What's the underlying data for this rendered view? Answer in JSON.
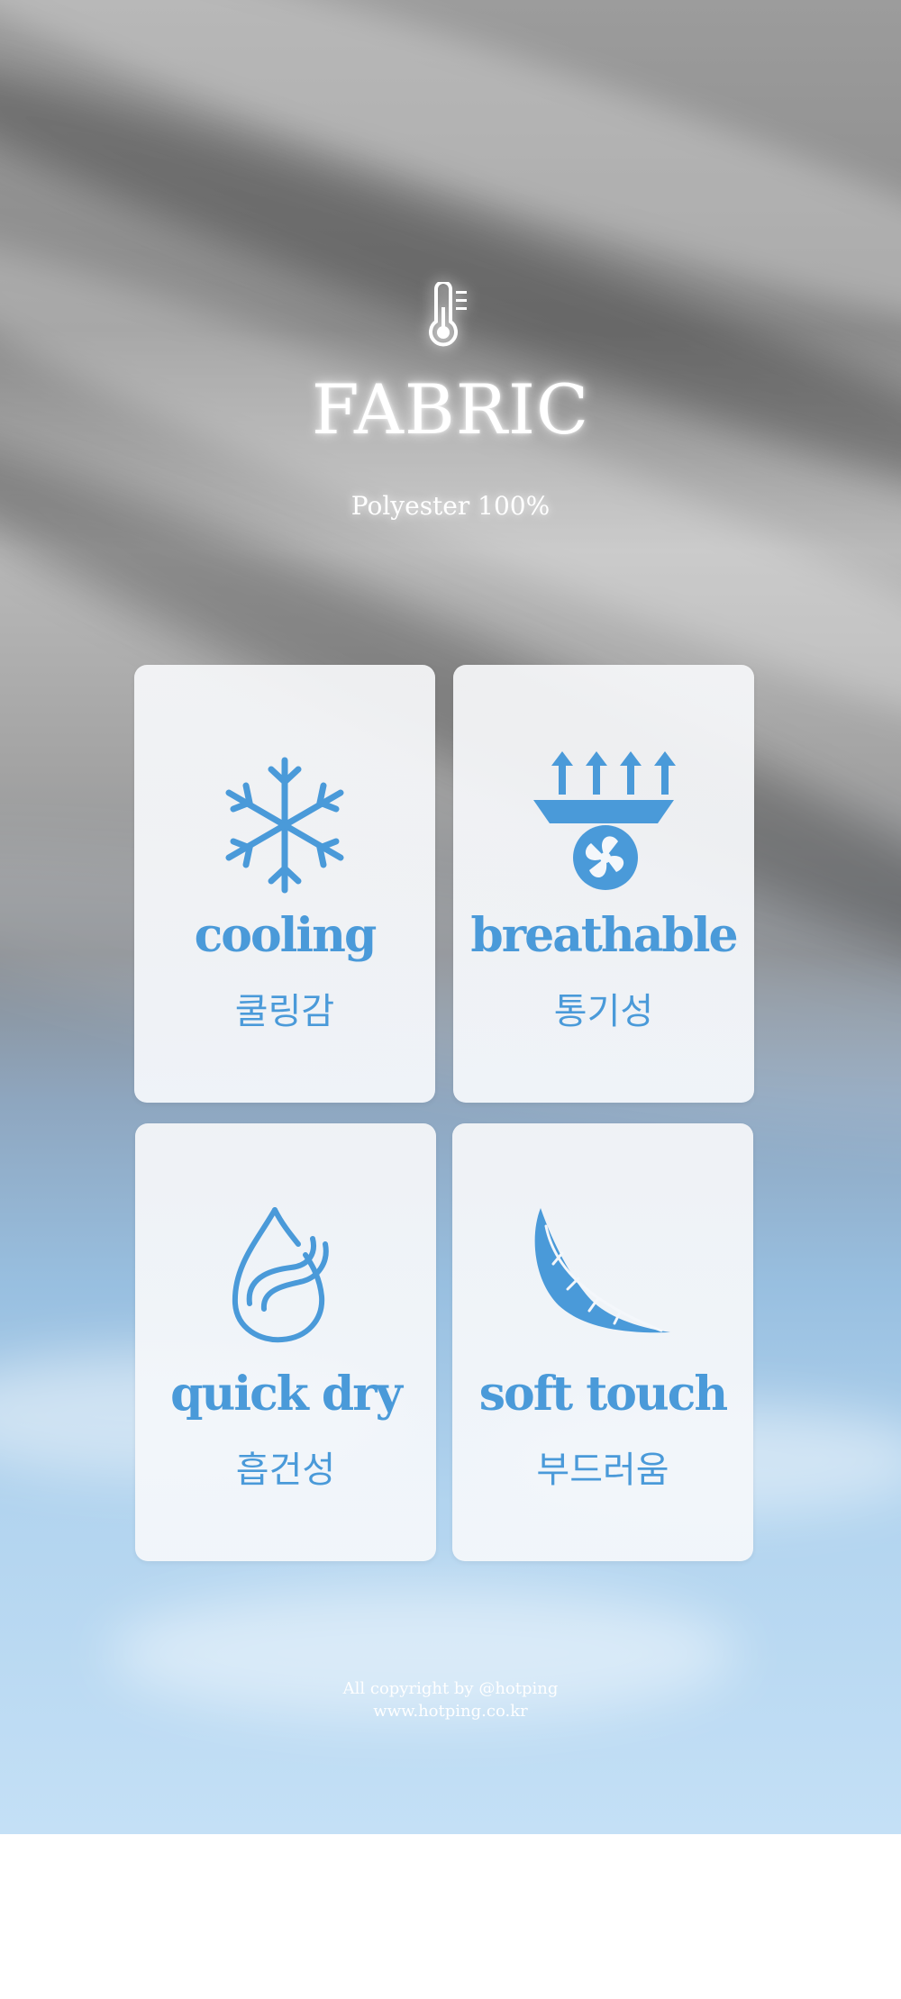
{
  "header": {
    "icon": "thermometer-icon",
    "title": "FABRIC",
    "subtitle": "Polyester 100%"
  },
  "features": [
    {
      "icon": "snowflake-icon",
      "label_en": "cooling",
      "label_ko": "쿨링감"
    },
    {
      "icon": "fan-airflow-icon",
      "label_en": "breathable",
      "label_ko": "통기성"
    },
    {
      "icon": "water-drop-icon",
      "label_en": "quick dry",
      "label_ko": "흡건성"
    },
    {
      "icon": "feather-icon",
      "label_en": "soft touch",
      "label_ko": "부드러움"
    }
  ],
  "footer": {
    "copyright": "All copyright by @hotping",
    "url": "www.hotping.co.kr"
  },
  "colors": {
    "accent": "#4a9ad9",
    "text_light": "#ffffff"
  }
}
